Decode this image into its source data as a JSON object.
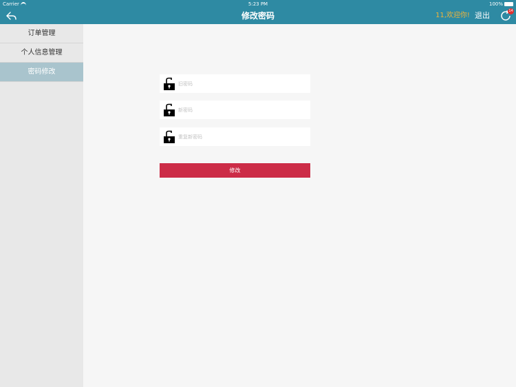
{
  "status_bar": {
    "carrier": "Carrier",
    "time": "5:23 PM",
    "battery": "100%"
  },
  "nav": {
    "title": "修改密码",
    "welcome": "11,欢迎你!",
    "logout": "退出",
    "badge_count": "14",
    "back_icon": "back-arrow-icon",
    "refresh_icon": "refresh-icon"
  },
  "sidebar": {
    "items": [
      {
        "label": "订单管理",
        "active": false
      },
      {
        "label": "个人信息管理",
        "active": false
      },
      {
        "label": "密码修改",
        "active": true
      }
    ]
  },
  "form": {
    "old_password": {
      "placeholder": "旧密码",
      "value": ""
    },
    "new_password": {
      "placeholder": "新密码",
      "value": ""
    },
    "repeat_password": {
      "placeholder": "重复新密码",
      "value": ""
    },
    "submit_label": "修改"
  },
  "colors": {
    "nav_bg": "#2e8aa3",
    "welcome": "#f0b43a",
    "submit": "#cc2c47",
    "sidebar_active": "#a9c4cd"
  }
}
